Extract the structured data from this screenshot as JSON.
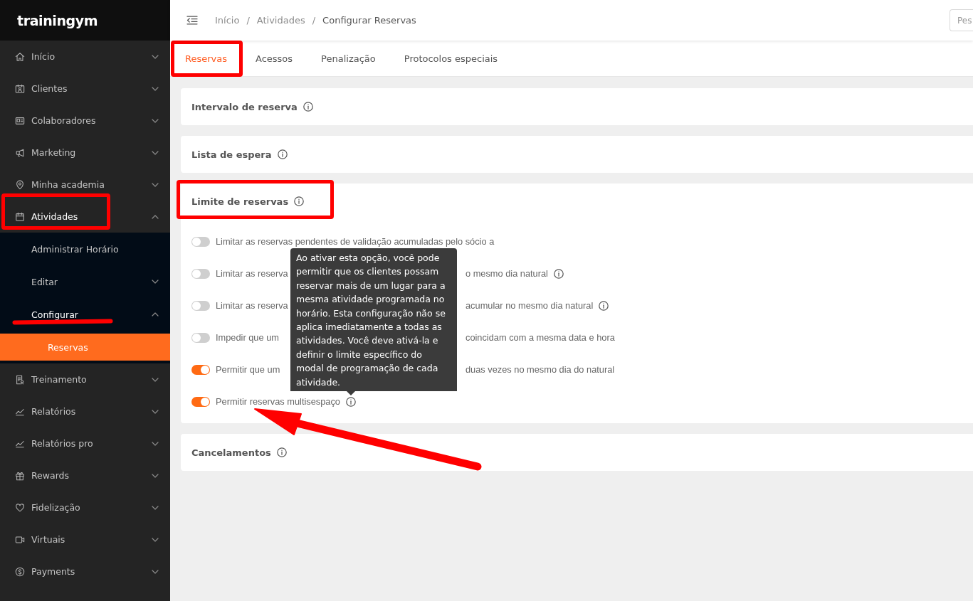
{
  "sidebar": {
    "logo": "trainingym",
    "items": [
      {
        "label": "Início",
        "selected": false,
        "expanded": false,
        "highlighted": false
      },
      {
        "label": "Clientes",
        "selected": false,
        "expanded": false,
        "highlighted": false
      },
      {
        "label": "Colaboradores",
        "selected": false,
        "expanded": false,
        "highlighted": false
      },
      {
        "label": "Marketing",
        "selected": false,
        "expanded": false,
        "highlighted": false
      },
      {
        "label": "Minha academia",
        "selected": false,
        "expanded": false,
        "highlighted": false
      },
      {
        "label": "Atividades",
        "selected": false,
        "expanded": true,
        "highlighted": true,
        "children": [
          {
            "label": "Administrar Horário",
            "selected": false,
            "underlined": false
          },
          {
            "label": "Editar",
            "selected": false,
            "expanded": false,
            "underlined": false
          },
          {
            "label": "Configurar",
            "selected": false,
            "expanded": true,
            "underlined": true,
            "children": [
              {
                "label": "Reservas",
                "selected": true
              }
            ]
          }
        ]
      },
      {
        "label": "Treinamento",
        "selected": false,
        "expanded": false,
        "highlighted": false
      },
      {
        "label": "Relatórios",
        "selected": false,
        "expanded": false,
        "highlighted": false
      },
      {
        "label": "Relatórios pro",
        "selected": false,
        "expanded": false,
        "highlighted": false
      },
      {
        "label": "Rewards",
        "selected": false,
        "expanded": false,
        "highlighted": false
      },
      {
        "label": "Fidelização",
        "selected": false,
        "expanded": false,
        "highlighted": false
      },
      {
        "label": "Virtuais",
        "selected": false,
        "expanded": false,
        "highlighted": false
      },
      {
        "label": "Payments",
        "selected": false,
        "expanded": false,
        "highlighted": false
      }
    ]
  },
  "topbar": {
    "breadcrumb": [
      {
        "text": "Início",
        "kind": "link"
      },
      {
        "text": "/",
        "kind": "separator"
      },
      {
        "text": "Atividades",
        "kind": "link"
      },
      {
        "text": "/",
        "kind": "separator"
      },
      {
        "text": "Configurar Reservas",
        "kind": "current"
      }
    ],
    "search": {
      "placeholder": "Pes"
    }
  },
  "tabs": [
    {
      "label": "Reservas",
      "selected": true,
      "highlighted": true
    },
    {
      "label": "Acessos",
      "selected": false,
      "highlighted": false
    },
    {
      "label": "Penalização",
      "selected": false,
      "highlighted": false
    },
    {
      "label": "Protocolos especiais",
      "selected": false,
      "highlighted": false
    }
  ],
  "sections": [
    {
      "title": "Intervalo de reserva",
      "info": true,
      "highlighted": false
    },
    {
      "title": "Lista de espera",
      "info": true,
      "highlighted": false
    },
    {
      "title": "Limite de reservas",
      "info": true,
      "highlighted": true,
      "options": [
        {
          "label": [
            "Limitar as reservas pendentes de validação acumuladas pelo sócio a"
          ],
          "on": false,
          "info": false,
          "pointed_at": false
        },
        {
          "label": [
            "Limitar as reserva",
            "o mesmo dia natural"
          ],
          "on": false,
          "info": true,
          "pointed_at": false
        },
        {
          "label": [
            "Limitar as reserva",
            "acumular no mesmo dia natural"
          ],
          "on": false,
          "info": true,
          "pointed_at": false
        },
        {
          "label": [
            "Impedir que um",
            "coincidam com a mesma data e hora"
          ],
          "on": false,
          "info": false,
          "pointed_at": false
        },
        {
          "label": [
            "Permitir que um",
            "duas vezes no mesmo dia do natural"
          ],
          "on": true,
          "info": false,
          "pointed_at": false
        },
        {
          "label": [
            "Permitir reservas multisespaço"
          ],
          "on": true,
          "info": true,
          "pointed_at": true,
          "tooltip": "Ao ativar esta opção, você pode permitir que os clientes possam reservar mais de um lugar para a mesma atividade programada no horário. Esta configuração não se aplica imediatamente a todas as atividades. Você deve ativá-la e definir o limite específico do modal de programação de cada atividade."
        }
      ]
    },
    {
      "title": "Cancelamentos",
      "info": true,
      "highlighted": false
    }
  ]
}
